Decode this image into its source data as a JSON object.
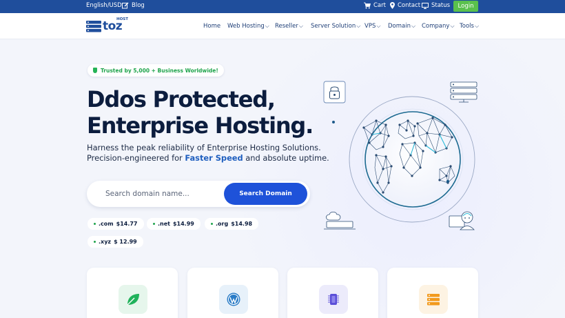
{
  "topbar": {
    "language": "English/USD",
    "blog": "Blog",
    "cart": "Cart",
    "contact": "Contact",
    "status": "Status",
    "login": "Login"
  },
  "logo": {
    "word": "toz",
    "super": "HOST"
  },
  "nav": {
    "home": "Home",
    "web_hosting": "Web Hosting",
    "reseller": "Reseller",
    "server_solution": "Server Solution",
    "vps": "VPS",
    "domain": "Domain",
    "company": "Company",
    "tools": "Tools"
  },
  "hero": {
    "badge": "Trusted by 5,000 + Business Worldwide!",
    "title_line1": "Ddos Protected,",
    "title_line2": "Enterprise Hosting.",
    "subtitle_line1": "Harness the peak reliability of Enterprise Hosting Solutions.",
    "subtitle_line2_pre": "Precision-engineered for ",
    "subtitle_line2_highlight": "Faster Speed",
    "subtitle_line2_post": " and absolute uptime."
  },
  "search": {
    "placeholder": "Search domain name...",
    "button": "Search Domain"
  },
  "tlds": [
    {
      "name": ".com",
      "price": "$14.77"
    },
    {
      "name": ".net",
      "price": "$14.99"
    },
    {
      "name": ".org",
      "price": "$14.98"
    },
    {
      "name": ".xyz",
      "price": "$ 12.99"
    }
  ],
  "cards": [
    {
      "icon": "leaf-icon",
      "color": "#20b25b",
      "bg": "#e6f6ec"
    },
    {
      "icon": "wordpress-icon",
      "color": "#2a7cc7",
      "bg": "#e7f1fa"
    },
    {
      "icon": "cpu-icon",
      "color": "#5b4fd8",
      "bg": "#ecebfb"
    },
    {
      "icon": "server-icon",
      "color": "#f29a1d",
      "bg": "#fdf3e3"
    }
  ],
  "colors": {
    "topbar": "#1f4e9c",
    "login": "#5ac14d",
    "primary": "#1e52d9",
    "highlight": "#1f5fbf",
    "trust": "#1ea34b"
  }
}
